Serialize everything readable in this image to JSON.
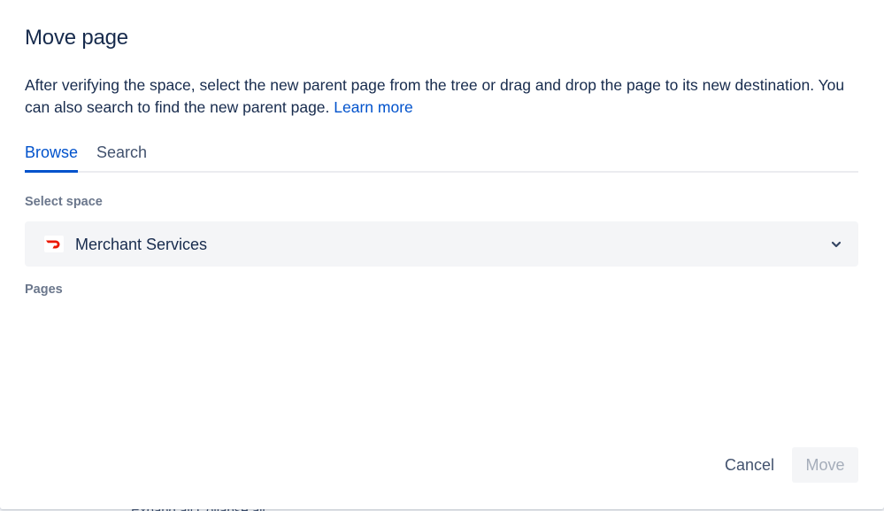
{
  "background": {
    "partial_text": "Expand all  Collapse all"
  },
  "dialog": {
    "title": "Move page",
    "description": "After verifying the space, select the new parent page from the tree or drag and drop the page to its new destination. You can also search to find the new parent page.",
    "learn_more_label": "Learn more",
    "tabs": [
      {
        "label": "Browse",
        "selected": true
      },
      {
        "label": "Search",
        "selected": false
      }
    ],
    "select_space_label": "Select space",
    "selected_space": {
      "name": "Merchant Services",
      "icon": "doordash-logo"
    },
    "pages_label": "Pages",
    "cancel_label": "Cancel",
    "move_label": "Move"
  },
  "colors": {
    "accent": "#0052cc",
    "text": "#172b4d",
    "muted": "#6b778c",
    "brand_logo": "#eb1700"
  }
}
